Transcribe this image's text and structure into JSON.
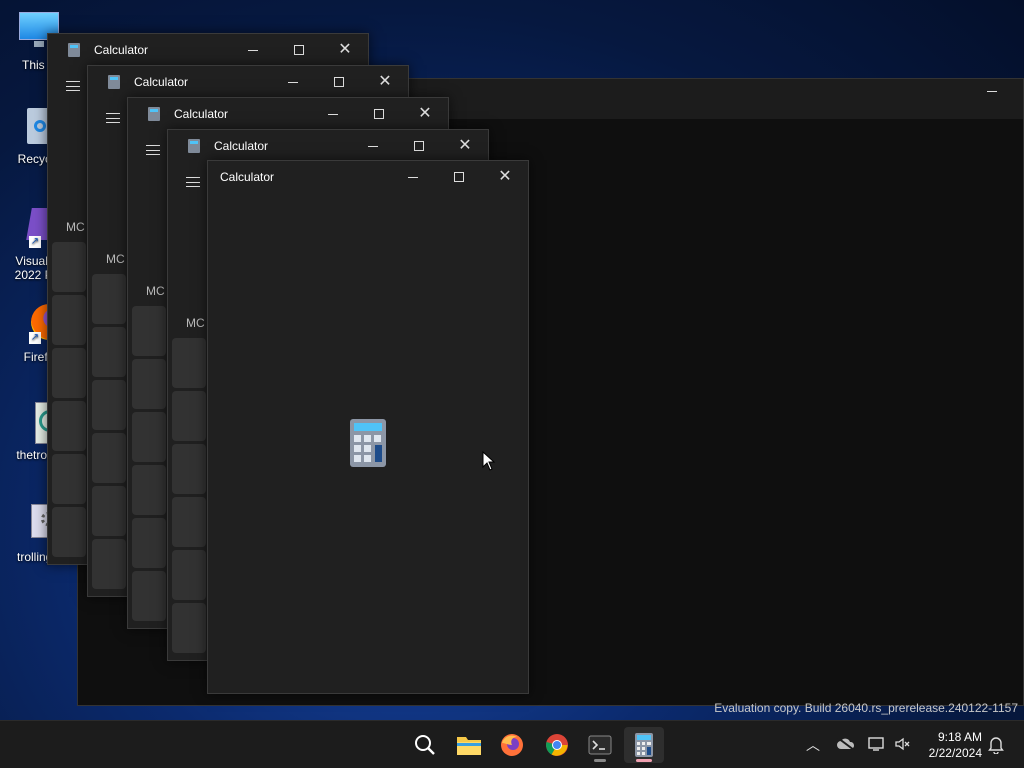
{
  "desktop": {
    "icons": [
      {
        "label": "This P"
      },
      {
        "label": "Recycle"
      },
      {
        "label": "Visual St\n2022 Pre"
      },
      {
        "label": "Firefo"
      },
      {
        "label": "thetrollin"
      },
      {
        "label": "trollingis"
      }
    ]
  },
  "calculator_windows": [
    {
      "title": "Calculator",
      "mc_label": "MC"
    },
    {
      "title": "Calculator",
      "mc_label": "MC"
    },
    {
      "title": "Calculator",
      "mc_label": "MC"
    },
    {
      "title": "Calculator",
      "mc_label": "MC"
    },
    {
      "title": "Calculator"
    }
  ],
  "watermark": "Evaluation copy. Build 26040.rs_prerelease.240122-1157",
  "taskbar": {
    "apps": [
      {
        "name": "search"
      },
      {
        "name": "file-explorer"
      },
      {
        "name": "firefox"
      },
      {
        "name": "chrome"
      },
      {
        "name": "terminal"
      },
      {
        "name": "calculator",
        "active": true
      }
    ],
    "clock": {
      "time": "9:18 AM",
      "date": "2/22/2024"
    }
  },
  "colors": {
    "accent": "#4fc3f7",
    "window_bg": "#202020",
    "taskbar_bg": "#1c1c1c"
  }
}
